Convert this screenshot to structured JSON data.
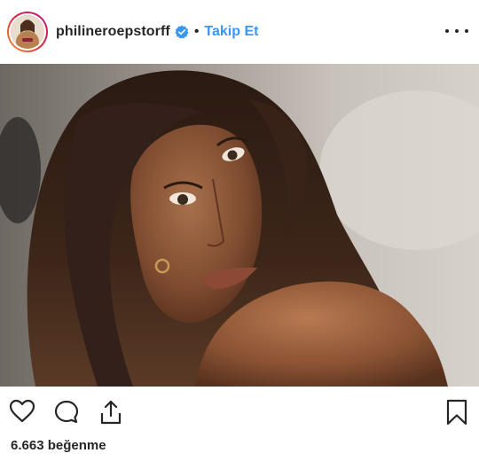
{
  "header": {
    "username": "philineroepstorff",
    "separator": "•",
    "follow_label": "Takip Et"
  },
  "icons": {
    "like": "heart-outline-icon",
    "comment": "comment-bubble-icon",
    "share": "share-upload-icon",
    "save": "bookmark-icon",
    "more": "more-horizontal-icon",
    "verified": "verified-badge-icon"
  },
  "colors": {
    "follow_blue": "#3897f0",
    "verified_blue": "#3897f0",
    "text": "#262626"
  },
  "stats": {
    "likes_label": "6.663 beğenme"
  }
}
